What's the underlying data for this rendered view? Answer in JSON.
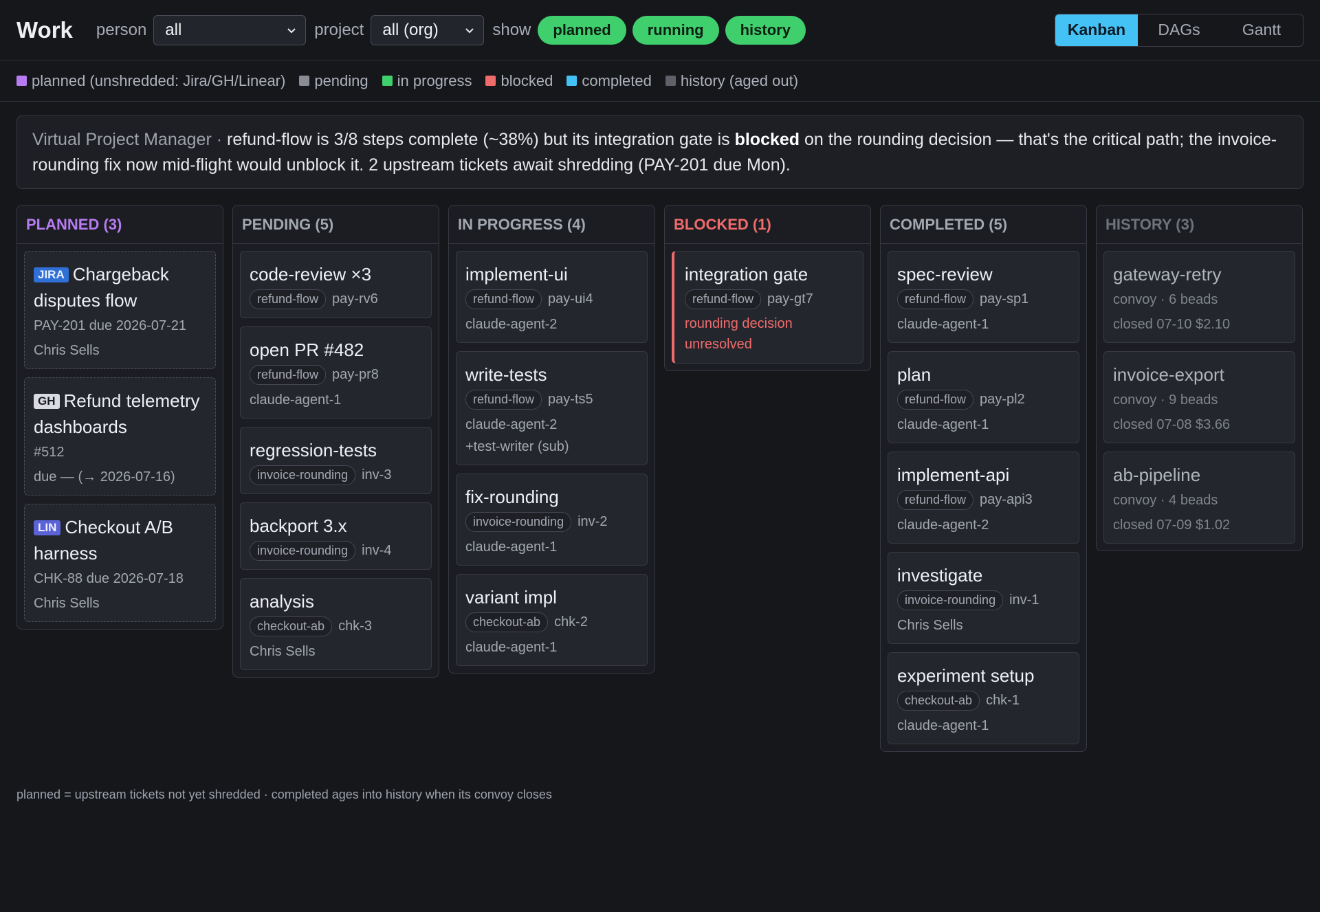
{
  "topbar": {
    "title": "Work",
    "person_label": "person",
    "person_value": "all",
    "project_label": "project",
    "project_value": "all (org)",
    "show_label": "show",
    "pills": [
      "planned",
      "running",
      "history"
    ],
    "views": [
      "Kanban",
      "DAGs",
      "Gantt"
    ],
    "active_view": "Kanban"
  },
  "legend": [
    {
      "label": "planned (unshredded: Jira/GH/Linear)",
      "color": "#b77cf2"
    },
    {
      "label": "pending",
      "color": "#8a8d96"
    },
    {
      "label": "in progress",
      "color": "#3fcf6d"
    },
    {
      "label": "blocked",
      "color": "#f06b6b"
    },
    {
      "label": "completed",
      "color": "#45c2f5"
    },
    {
      "label": "history (aged out)",
      "color": "#5e616a"
    }
  ],
  "vpm": {
    "label": "Virtual Project Manager · ",
    "text_1": "refund-flow is 3/8 steps complete (~38%) but its integration gate is ",
    "text_bold": "blocked",
    "text_2": " on the rounding decision — that's the critical path; the invoice-rounding fix now mid-flight would unblock it. 2 upstream tickets await shredding (PAY-201 due Mon)."
  },
  "columns": {
    "planned": {
      "title": "PLANNED (3)",
      "color": "#b77cf2",
      "cards": [
        {
          "source": "JIRA",
          "title": "Chargeback disputes flow",
          "ref": "PAY-201  due 2026-07-21",
          "owner": "Chris Sells"
        },
        {
          "source": "GH",
          "title": "Refund telemetry dashboards",
          "ref": "#512",
          "owner": "due — (→ 2026-07-16)"
        },
        {
          "source": "LIN",
          "title": "Checkout A/B harness",
          "ref": "CHK-88  due 2026-07-18",
          "owner": "Chris Sells"
        }
      ]
    },
    "pending": {
      "title": "PENDING (5)",
      "color": "#a3a7b0",
      "cards": [
        {
          "title": "code-review ×3",
          "tag": "refund-flow",
          "id": "pay-rv6"
        },
        {
          "title": "open PR #482",
          "tag": "refund-flow",
          "id": "pay-pr8",
          "agent": "claude-agent-1"
        },
        {
          "title": "regression-tests",
          "tag": "invoice-rounding",
          "id": "inv-3"
        },
        {
          "title": "backport 3.x",
          "tag": "invoice-rounding",
          "id": "inv-4"
        },
        {
          "title": "analysis",
          "tag": "checkout-ab",
          "id": "chk-3",
          "agent": "Chris Sells"
        }
      ]
    },
    "in_progress": {
      "title": "IN PROGRESS (4)",
      "color": "#a3a7b0",
      "cards": [
        {
          "title": "implement-ui",
          "tag": "refund-flow",
          "id": "pay-ui4",
          "agent": "claude-agent-2"
        },
        {
          "title": "write-tests",
          "tag": "refund-flow",
          "id": "pay-ts5",
          "agent": "claude-agent-2",
          "sub": "+test-writer (sub)"
        },
        {
          "title": "fix-rounding",
          "tag": "invoice-rounding",
          "id": "inv-2",
          "agent": "claude-agent-1"
        },
        {
          "title": "variant impl",
          "tag": "checkout-ab",
          "id": "chk-2",
          "agent": "claude-agent-1"
        }
      ]
    },
    "blocked": {
      "title": "BLOCKED (1)",
      "color": "#f06b6b",
      "cards": [
        {
          "title": "integration gate",
          "tag": "refund-flow",
          "id": "pay-gt7",
          "reason": "rounding decision unresolved"
        }
      ]
    },
    "completed": {
      "title": "COMPLETED (5)",
      "color": "#a3a7b0",
      "cards": [
        {
          "title": "spec-review",
          "tag": "refund-flow",
          "id": "pay-sp1",
          "agent": "claude-agent-1"
        },
        {
          "title": "plan",
          "tag": "refund-flow",
          "id": "pay-pl2",
          "agent": "claude-agent-1"
        },
        {
          "title": "implement-api",
          "tag": "refund-flow",
          "id": "pay-api3",
          "agent": "claude-agent-2"
        },
        {
          "title": "investigate",
          "tag": "invoice-rounding",
          "id": "inv-1",
          "agent": "Chris Sells"
        },
        {
          "title": "experiment setup",
          "tag": "checkout-ab",
          "id": "chk-1",
          "agent": "claude-agent-1"
        }
      ]
    },
    "history": {
      "title": "HISTORY (3)",
      "color": "#6e727b",
      "cards": [
        {
          "title": "gateway-retry",
          "summary": "convoy · 6 beads",
          "closed": "closed 07-10  $2.10"
        },
        {
          "title": "invoice-export",
          "summary": "convoy · 9 beads",
          "closed": "closed 07-08  $3.66"
        },
        {
          "title": "ab-pipeline",
          "summary": "convoy · 4 beads",
          "closed": "closed 07-09  $1.02"
        }
      ]
    }
  },
  "footnote": "planned = upstream tickets not yet shredded · completed ages into history when its convoy closes"
}
